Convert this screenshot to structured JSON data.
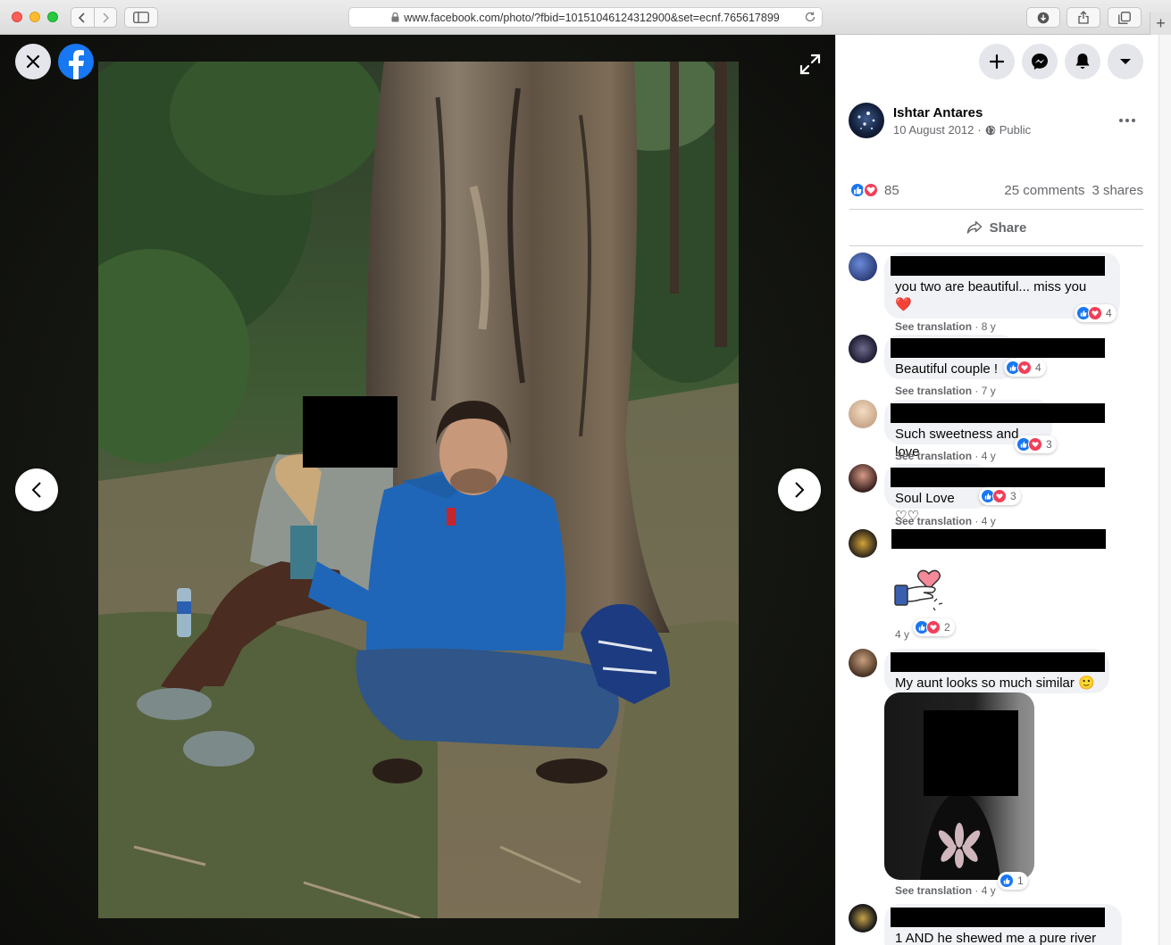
{
  "browser": {
    "url": "www.facebook.com/photo/?fbid=10151046124312900&set=ecnf.765617899"
  },
  "post": {
    "author": "Ishtar Antares",
    "date": "10 August 2012",
    "separator": "·",
    "audience": "Public",
    "reaction_count": "85",
    "comments_count": "25 comments",
    "shares_count": "3 shares",
    "share_label": "Share"
  },
  "comments": [
    {
      "text_line1": "you two are beautiful... miss you",
      "text_line2": "❤️",
      "translate": "See translation",
      "time": "· 8 y",
      "reactions": "4"
    },
    {
      "text_line1": "Beautiful couple !",
      "translate": "See translation",
      "time": "· 7 y",
      "reactions": "4"
    },
    {
      "text_line1": "Such sweetness and love",
      "translate": "See translation",
      "time": "· 4 y",
      "reactions": "3"
    },
    {
      "text_line1": "Soul Love ♡♡",
      "translate": "See translation",
      "time": "· 4 y",
      "reactions": "3"
    },
    {
      "time": "4 y",
      "reactions": "2"
    },
    {
      "text_line1": "My aunt looks so much similar 🙂",
      "translate": "See translation",
      "time": "· 4 y",
      "reactions": "1"
    },
    {
      "text_line1": "1 AND he shewed me a pure river"
    }
  ],
  "colors": {
    "facebook_blue": "#1877f2",
    "love_red": "#f33e58",
    "secondary_text": "#65676b",
    "bubble_bg": "#f0f2f5"
  },
  "icons": [
    "close-icon",
    "facebook-logo-icon",
    "expand-icon",
    "chevron-left-icon",
    "chevron-right-icon",
    "plus-icon",
    "messenger-icon",
    "bell-icon",
    "caret-down-icon",
    "globe-icon",
    "more-dots-icon",
    "share-arrow-icon",
    "like-icon",
    "love-icon"
  ]
}
